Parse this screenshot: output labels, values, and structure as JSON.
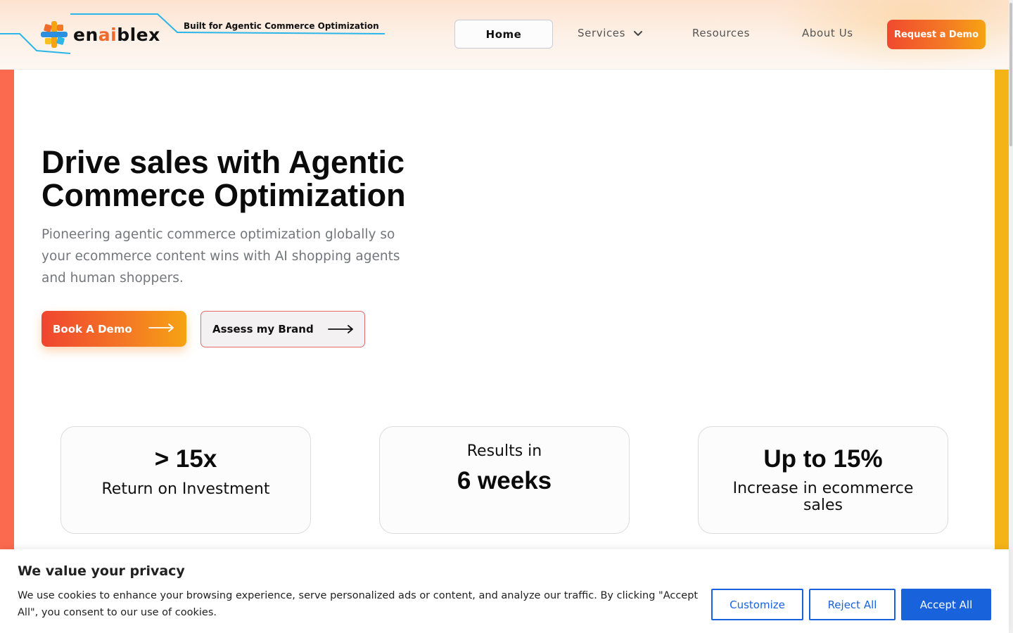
{
  "header": {
    "logo_text_pre": "en",
    "logo_text_ai": "ai",
    "logo_text_post": "blex",
    "tagline": "Built for Agentic Commerce Optimization",
    "nav": {
      "home": "Home",
      "services": "Services",
      "resources": "Resources",
      "about": "About Us"
    },
    "cta": "Request a Demo"
  },
  "hero": {
    "title": "Drive sales with Agentic Commerce Optimization",
    "subtitle": "Pioneering agentic commerce optimization globally so your ecommerce content wins with AI shopping agents and human shoppers.",
    "primary_button": "Book A Demo",
    "secondary_button": "Assess my Brand"
  },
  "stats": [
    {
      "big": "> 15x",
      "small": "Return on Investment"
    },
    {
      "small": "Results in",
      "big": "6 weeks"
    },
    {
      "big": "Up to 15%",
      "small": "Increase in ecommerce sales"
    }
  ],
  "cookie": {
    "title": "We value your privacy",
    "text": "We use cookies to enhance your browsing experience, serve personalized ads or content, and analyze our traffic. By clicking \"Accept All\", you consent to our use of cookies.",
    "customize": "Customize",
    "reject": "Reject All",
    "accept": "Accept All"
  },
  "colors": {
    "brand_orange": "#f47a24",
    "brand_red": "#f04530",
    "brand_yellow": "#f6a313",
    "cookie_blue": "#1863dc"
  },
  "icons": [
    "enaiblex-logo-icon",
    "chevron-down-icon",
    "arrow-right-icon"
  ]
}
